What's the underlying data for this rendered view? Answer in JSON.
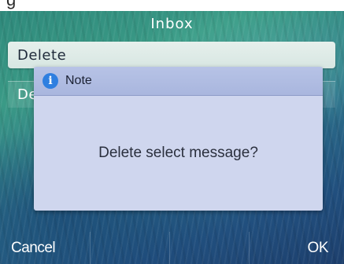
{
  "top_strip": {
    "text": "g"
  },
  "header": {
    "title": "Inbox"
  },
  "list": {
    "items": [
      {
        "label": "Delete"
      },
      {
        "label": "De"
      }
    ]
  },
  "dialog": {
    "icon": "info-icon",
    "title": "Note",
    "message": "Delete select message?"
  },
  "softkeys": {
    "left": "Cancel",
    "mid1": "",
    "mid2": "",
    "right": "OK"
  },
  "colors": {
    "dialog_bg": "#cfd6ee",
    "dialog_header": "#a9b6de",
    "info_icon": "#2f7fe0",
    "selected_item": "#dde9e5"
  }
}
